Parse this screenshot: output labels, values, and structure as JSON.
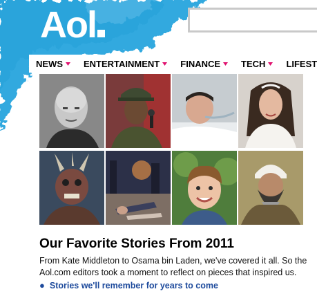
{
  "brand": {
    "logo_text": "Aol"
  },
  "search": {
    "placeholder": ""
  },
  "nav": {
    "items": [
      {
        "label": "NEWS"
      },
      {
        "label": "ENTERTAINMENT"
      },
      {
        "label": "FINANCE"
      },
      {
        "label": "TECH"
      },
      {
        "label": "LIFESTYLE"
      }
    ],
    "chevron_color": "#e0106e"
  },
  "feature": {
    "title": "Our Favorite Stories From 2011",
    "summary": "From Kate Middleton to Osama bin Laden, we've covered it all. So the Aol.com editors took a moment to reflect on pieces that inspired us.",
    "link_text": "Stories we'll remember for years to come",
    "link_color": "#1d4a9c"
  },
  "colors": {
    "splash": "#29a8e0",
    "search_border": "#c9c9c9"
  },
  "photos": [
    {
      "icon": "bald-man-portrait"
    },
    {
      "icon": "singer-with-microphone"
    },
    {
      "icon": "man-in-hospital-bed"
    },
    {
      "icon": "bride-with-tiara"
    },
    {
      "icon": "horned-costume-rocker"
    },
    {
      "icon": "couple-kissing-on-street"
    },
    {
      "icon": "smiling-boy"
    },
    {
      "icon": "bearded-man-in-turban"
    }
  ]
}
